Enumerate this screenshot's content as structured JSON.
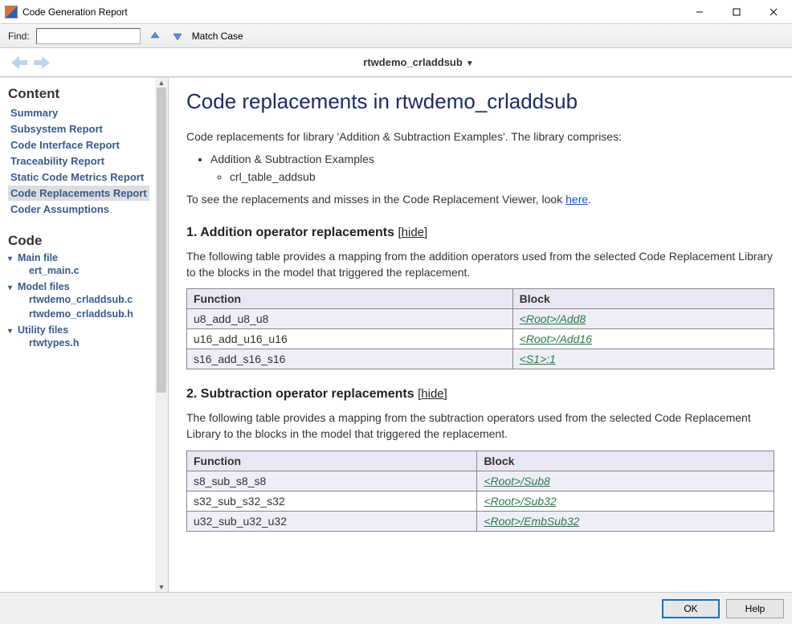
{
  "window": {
    "title": "Code Generation Report"
  },
  "findbar": {
    "label": "Find:",
    "value": "",
    "match_case": "Match Case"
  },
  "breadcrumb": {
    "text": "rtwdemo_crladdsub"
  },
  "sidebar": {
    "content_heading": "Content",
    "nav": [
      "Summary",
      "Subsystem Report",
      "Code Interface Report",
      "Traceability Report",
      "Static Code Metrics Report",
      "Code Replacements Report",
      "Coder Assumptions"
    ],
    "selected_index": 5,
    "code_heading": "Code",
    "file_groups": [
      {
        "label": "Main file",
        "files": [
          "ert_main.c"
        ]
      },
      {
        "label": "Model files",
        "files": [
          "rtwdemo_crladdsub.c",
          "rtwdemo_crladdsub.h"
        ]
      },
      {
        "label": "Utility files",
        "files": [
          "rtwtypes.h"
        ]
      }
    ]
  },
  "content": {
    "title": "Code replacements in rtwdemo_crladdsub",
    "intro": "Code replacements for library 'Addition & Subtraction Examples'. The library comprises:",
    "library_list": {
      "item": "Addition & Subtraction Examples",
      "subitem": "crl_table_addsub"
    },
    "viewer_sentence_pre": "To see the replacements and misses in the Code Replacement Viewer, look ",
    "viewer_link": "here",
    "viewer_sentence_post": ".",
    "sections": [
      {
        "heading": "1. Addition operator replacements",
        "hide_label": "hide",
        "description": "The following table provides a mapping from the addition operators used from the selected Code Replacement Library to the blocks in the model that triggered the replacement.",
        "columns": [
          "Function",
          "Block"
        ],
        "rows": [
          {
            "function": "u8_add_u8_u8",
            "block": "<Root>/Add8"
          },
          {
            "function": "u16_add_u16_u16",
            "block": "<Root>/Add16"
          },
          {
            "function": "s16_add_s16_s16",
            "block": "<S1>:1"
          }
        ]
      },
      {
        "heading": "2. Subtraction operator replacements",
        "hide_label": "hide",
        "description": "The following table provides a mapping from the subtraction operators used from the selected Code Replacement Library to the blocks in the model that triggered the replacement.",
        "columns": [
          "Function",
          "Block"
        ],
        "rows": [
          {
            "function": "s8_sub_s8_s8",
            "block": "<Root>/Sub8"
          },
          {
            "function": "s32_sub_s32_s32",
            "block": "<Root>/Sub32"
          },
          {
            "function": "u32_sub_u32_u32",
            "block": "<Root>/EmbSub32"
          }
        ]
      }
    ]
  },
  "footer": {
    "ok": "OK",
    "help": "Help"
  }
}
